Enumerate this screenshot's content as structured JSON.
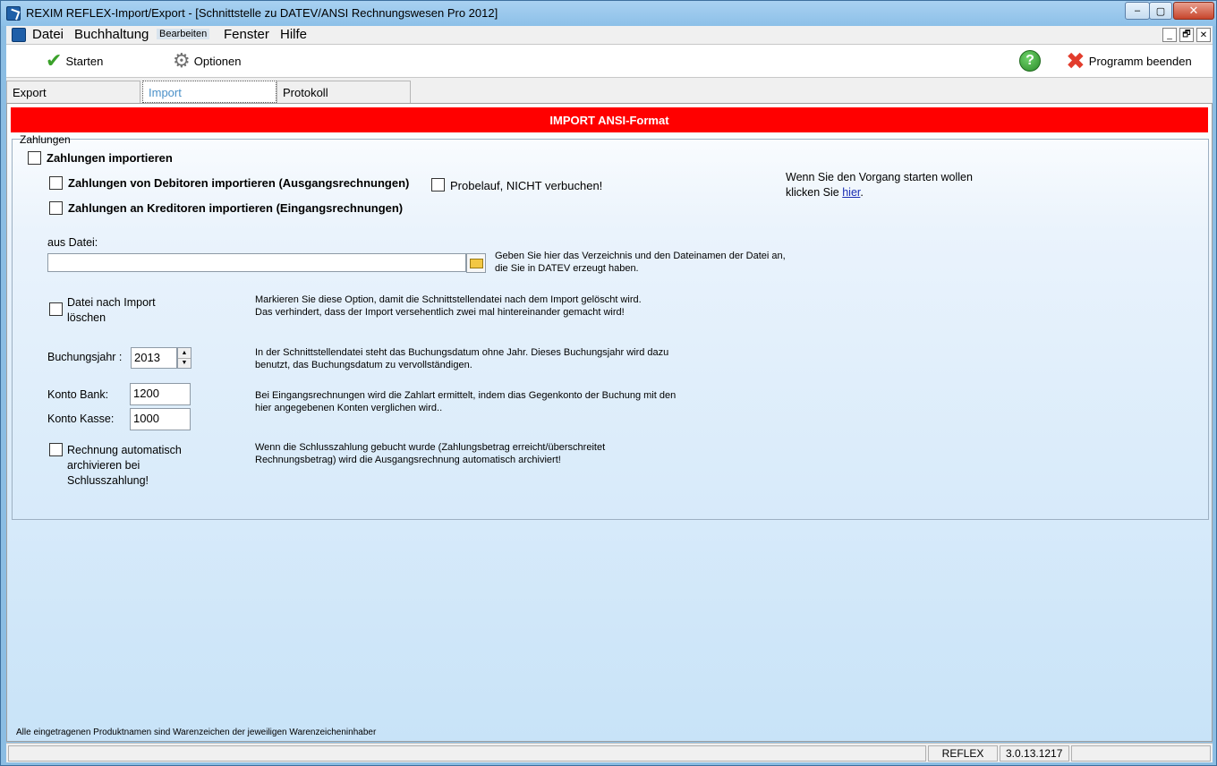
{
  "window": {
    "title": "REXIM REFLEX-Import/Export - [Schnittstelle zu DATEV/ANSI Rechnungswesen Pro 2012]",
    "controls": {
      "minimize": "‒",
      "maximize": "▢",
      "close": "✕"
    }
  },
  "menu": {
    "items": [
      "Datei",
      "Buchhaltung",
      "Bearbeiten",
      "Fenster",
      "Hilfe"
    ],
    "mdi_controls": [
      "_",
      "🗗",
      "✕"
    ]
  },
  "toolbar": {
    "start_label": "Starten",
    "options_label": "Optionen",
    "help_glyph": "?",
    "exit_label": "Programm beenden"
  },
  "tabs": [
    {
      "label": "Export",
      "active": false
    },
    {
      "label": "Import",
      "active": true
    },
    {
      "label": "Protokoll",
      "active": false
    }
  ],
  "banner": {
    "title": "IMPORT ANSI-Format"
  },
  "group": {
    "legend": "Zahlungen",
    "import_payments": {
      "label": "Zahlungen importieren",
      "checked": false
    },
    "debtors": {
      "label": "Zahlungen von Debitoren importieren (Ausgangsrechnungen)",
      "checked": false
    },
    "creditors": {
      "label": "Zahlungen an Kreditoren importieren (Eingangsrechnungen)",
      "checked": false
    },
    "test_run": {
      "label": "Probelauf, NICHT verbuchen!",
      "checked": false
    },
    "start_hint_line1": "Wenn Sie den Vorgang starten wollen",
    "start_hint_line2_prefix": "klicken Sie ",
    "start_hint_link": "hier",
    "start_hint_suffix": ".",
    "file": {
      "label": "aus Datei:",
      "value": "",
      "hint_line1": "Geben Sie hier das Verzeichnis und den Dateinamen der Datei an,",
      "hint_line2": "die Sie in DATEV erzeugt haben."
    },
    "delete_after": {
      "label_line1": "Datei nach Import",
      "label_line2": "löschen",
      "checked": false,
      "hint_line1": "Markieren Sie diese Option, damit die Schnittstellendatei nach dem Import gelöscht wird.",
      "hint_line2": "Das verhindert, dass der Import versehentlich zwei mal hintereinander gemacht wird!"
    },
    "year": {
      "label": "Buchungsjahr :",
      "value": "2013",
      "hint_line1": "In der Schnittstellendatei steht das Buchungsdatum ohne Jahr. Dieses Buchungsjahr wird dazu",
      "hint_line2": "benutzt, das Buchungsdatum zu vervollständigen."
    },
    "bank": {
      "label": "Konto Bank:",
      "value": "1200"
    },
    "cash": {
      "label": "Konto Kasse:",
      "value": "1000"
    },
    "accounts_hint_line1": "Bei Eingangsrechnungen wird die Zahlart ermittelt, indem dias Gegenkonto der Buchung mit den",
    "accounts_hint_line2": "hier angegebenen Konten verglichen wird..",
    "archive": {
      "label_line1": "Rechnung automatisch",
      "label_line2": "archivieren bei",
      "label_line3": "Schlusszahlung!",
      "checked": false,
      "hint_line1": "Wenn die Schlusszahlung gebucht wurde (Zahlungsbetrag erreicht/überschreitet",
      "hint_line2": "Rechnungsbetrag) wird die Ausgangsrechnung automatisch archiviert!"
    }
  },
  "footer_note": "Alle eingetragenen Produktnamen sind Warenzeichen der jeweiligen Warenzeicheninhaber",
  "status": {
    "app": "REFLEX",
    "version": "3.0.13.1217"
  },
  "colors": {
    "banner": "#ff0000",
    "link": "#1a2db3",
    "active_tab_text": "#4a90c8"
  }
}
